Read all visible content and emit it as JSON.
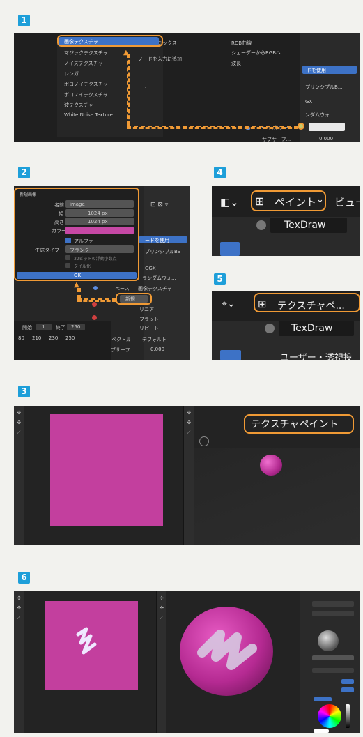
{
  "steps": {
    "s1": "1",
    "s2": "2",
    "s3": "3",
    "s4": "4",
    "s5": "5",
    "s6": "6"
  },
  "panel1": {
    "texture_menu": [
      "画像テクスチャ",
      "マジックテクスチャ",
      "ノイズテクスチャ",
      "レンガ",
      "ボロノイテクスチャ",
      "ボロノイテクスチャ",
      "波テクスチャ",
      "White Noise Texture"
    ],
    "mix_label": "ミックス",
    "node_hint": "ノードを入力に追加",
    "rgb_items": [
      "RGB曲線",
      "シェーダーからRGBへ",
      "波長"
    ],
    "side_button": "ドを使用",
    "side_principled": "プリンシプルB...",
    "side_gx": "GX",
    "side_random_walk": "ンダムウォ...",
    "side_color_label": "ベースカラー",
    "side_subsurf": "サブサーフ...",
    "side_subsurf_value": "0.000"
  },
  "panel2": {
    "dialog_title": "新規画像",
    "name_label": "名前",
    "name_value": "image",
    "width_label": "幅",
    "width_value": "1024 px",
    "height_label": "高さ",
    "height_value": "1024 px",
    "color_label": "カラー",
    "alpha_label": "アルファ",
    "gen_type_label": "生成タイプ",
    "gen_type_value": "ブランク",
    "float_label": "32ビットの浮動小数点",
    "tiled_label": "タイル化",
    "ok_label": "OK",
    "side_use_nodes": "ードを使用",
    "side_principled": "プリンシプルBS",
    "side_gx": "GGX",
    "side_random": "ランダムウォ...",
    "base_label": "ベース",
    "image_tex": "画像テクスチャ",
    "new_button": "新規",
    "linear": "リニア",
    "flat": "フラット",
    "repeat": "リピート",
    "vector_label": "ベクトル",
    "default_label": "デフォルト",
    "subsurf_label": "サブサーフ",
    "subsurf_value": "0.000",
    "frame_row": [
      "開始",
      "1",
      "終了",
      "250"
    ],
    "ruler": [
      "80",
      "210",
      "230",
      "250"
    ]
  },
  "panel3": {
    "mode_label": "テクスチャペイント"
  },
  "panel4": {
    "mode_label": "ペイント",
    "view_label": "ビュー",
    "brush_label": "TexDraw"
  },
  "panel5": {
    "mode_label": "テクスチャペ...",
    "brush_label": "TexDraw",
    "user_label": "ユーザー・透視投"
  },
  "colors": {
    "accent_orange": "#f09a35",
    "blender_blue": "#3d72c6",
    "paint_magenta": "#c648a5",
    "step_blue": "#1e9fd9"
  }
}
